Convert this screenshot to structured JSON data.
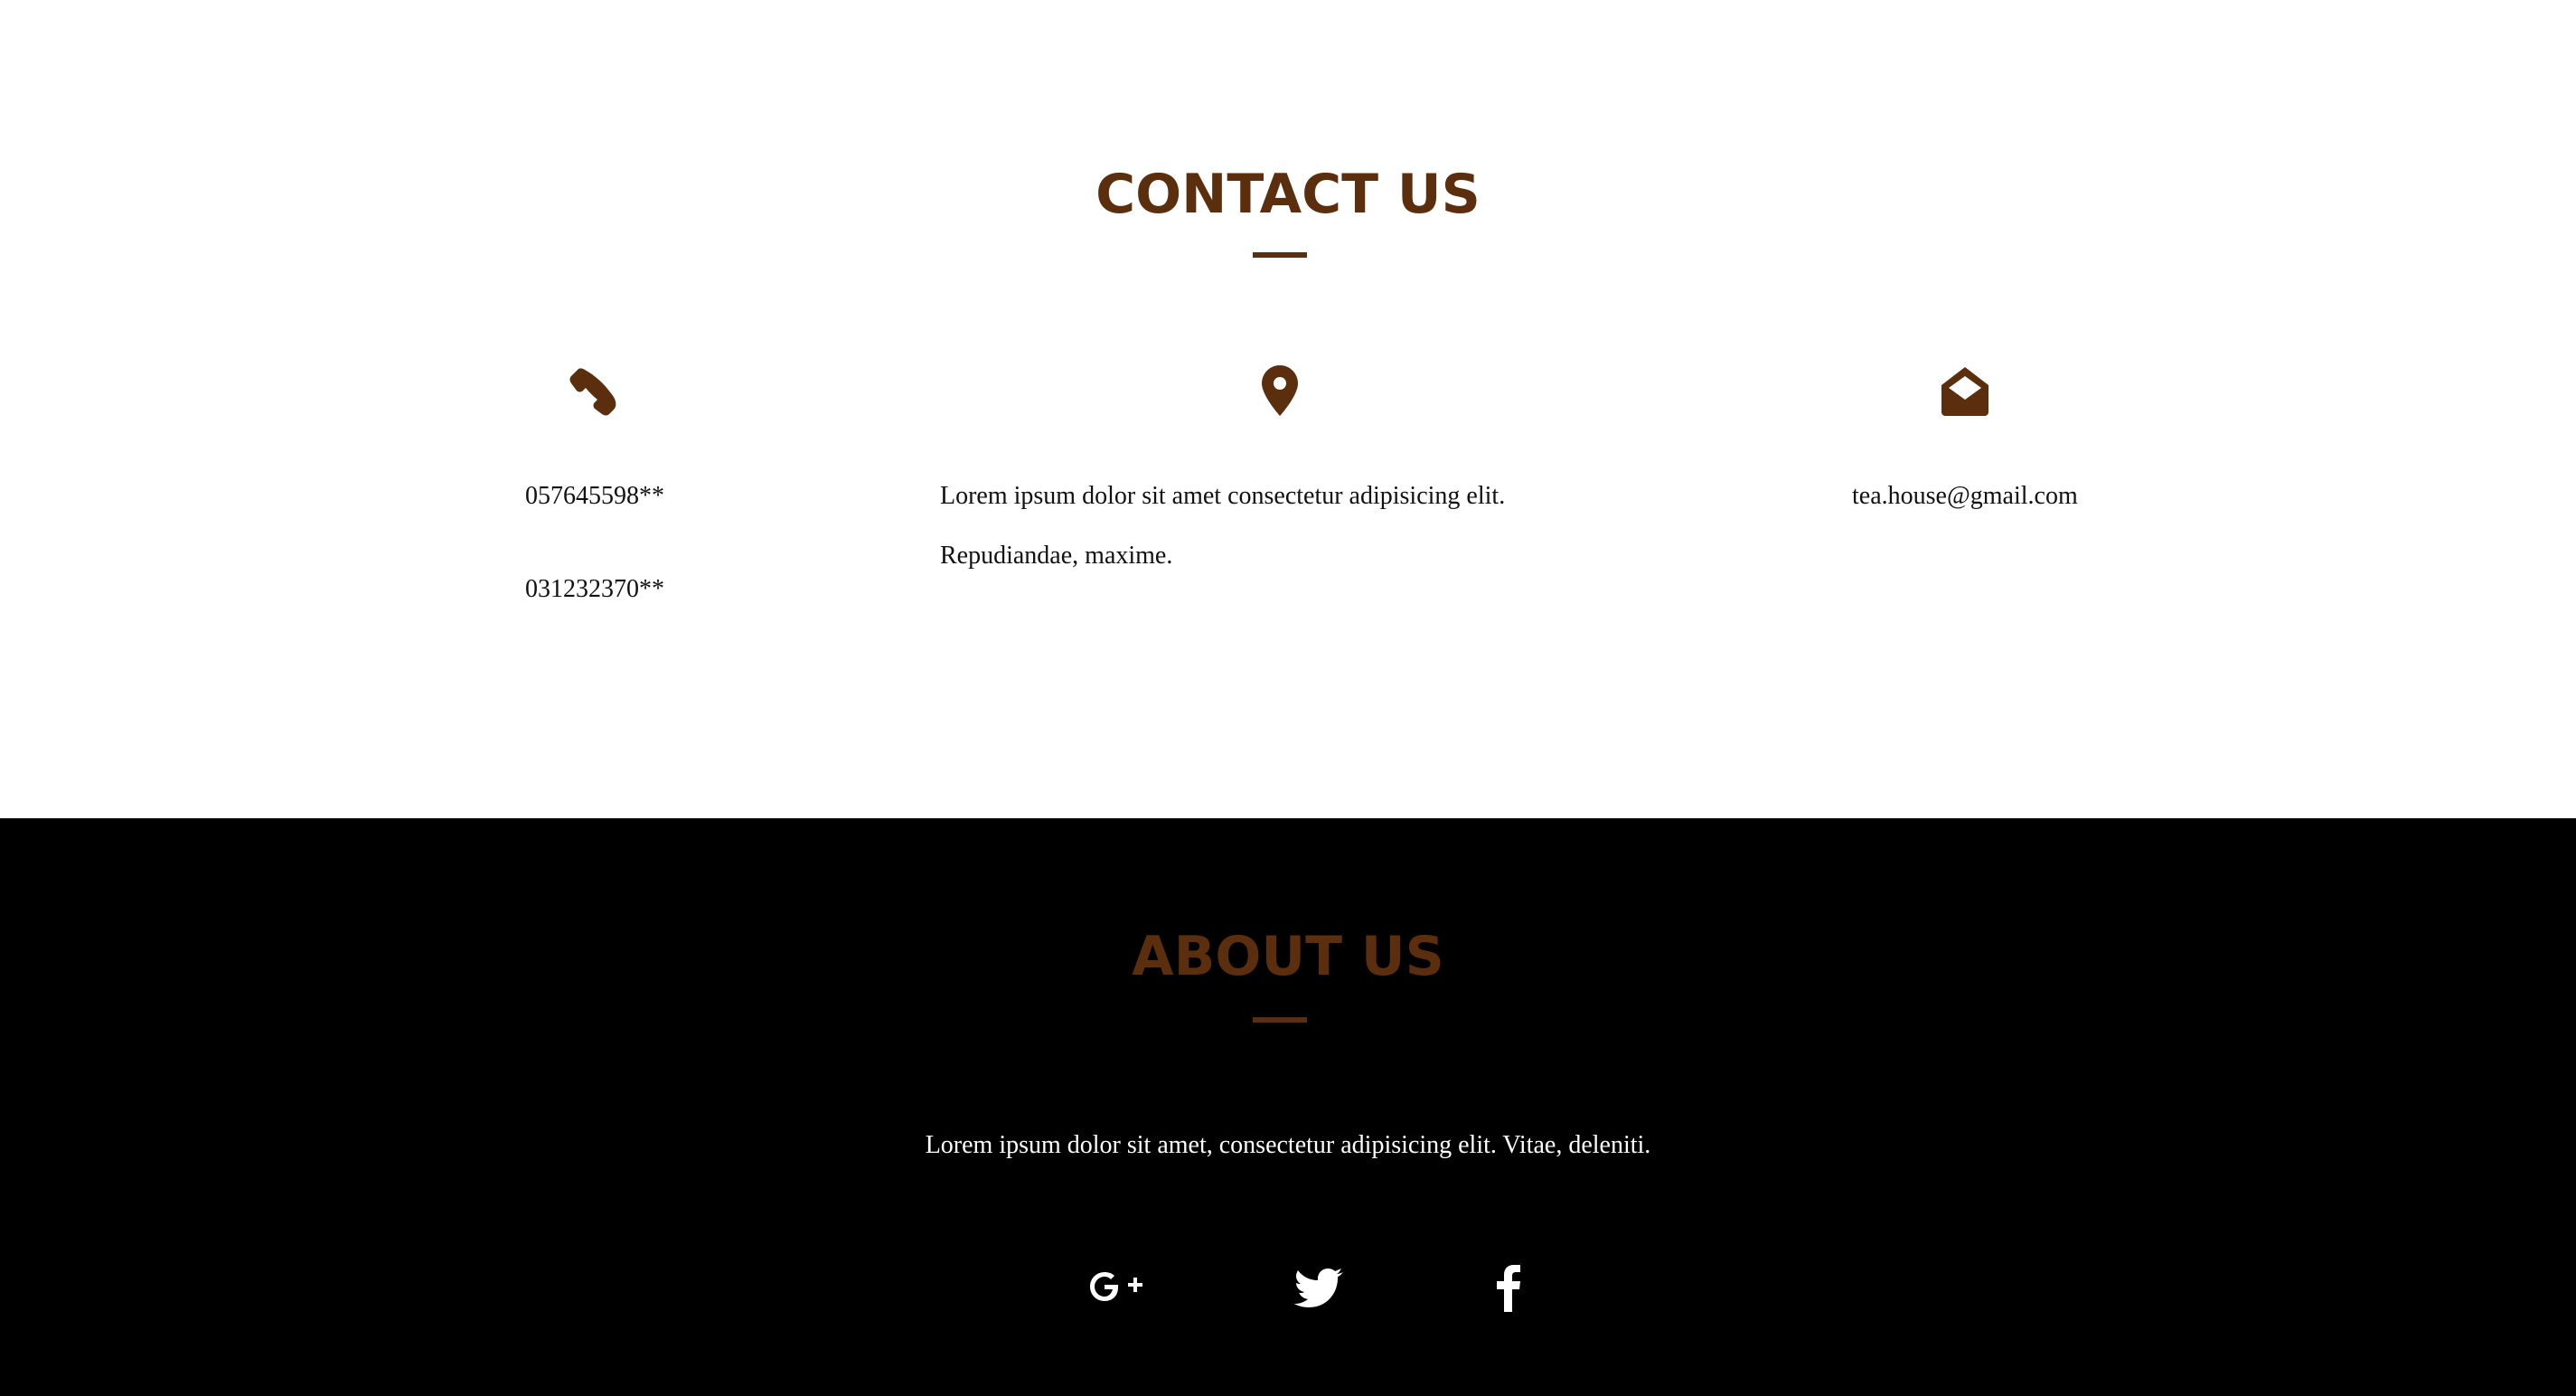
{
  "contact": {
    "title": "CONTACT US",
    "phone": {
      "icon": "phone-icon",
      "numbers": [
        "057645598**",
        "031232370**"
      ]
    },
    "address": {
      "icon": "map-marker-icon",
      "lines": [
        "Lorem ipsum dolor sit amet consectetur adipisicing elit.",
        "Repudiandae, maxime."
      ]
    },
    "email": {
      "icon": "envelope-open-icon",
      "value": "tea.house@gmail.com"
    }
  },
  "about": {
    "title": "ABOUT US",
    "text": "Lorem ipsum dolor sit amet, consectetur adipisicing elit. Vitae, deleniti.",
    "social": [
      {
        "icon": "google-plus-icon"
      },
      {
        "icon": "twitter-icon"
      },
      {
        "icon": "facebook-icon"
      }
    ]
  },
  "colors": {
    "accent": "#5b2e0e",
    "about_background": "#000000",
    "contact_background": "#ffffff"
  }
}
